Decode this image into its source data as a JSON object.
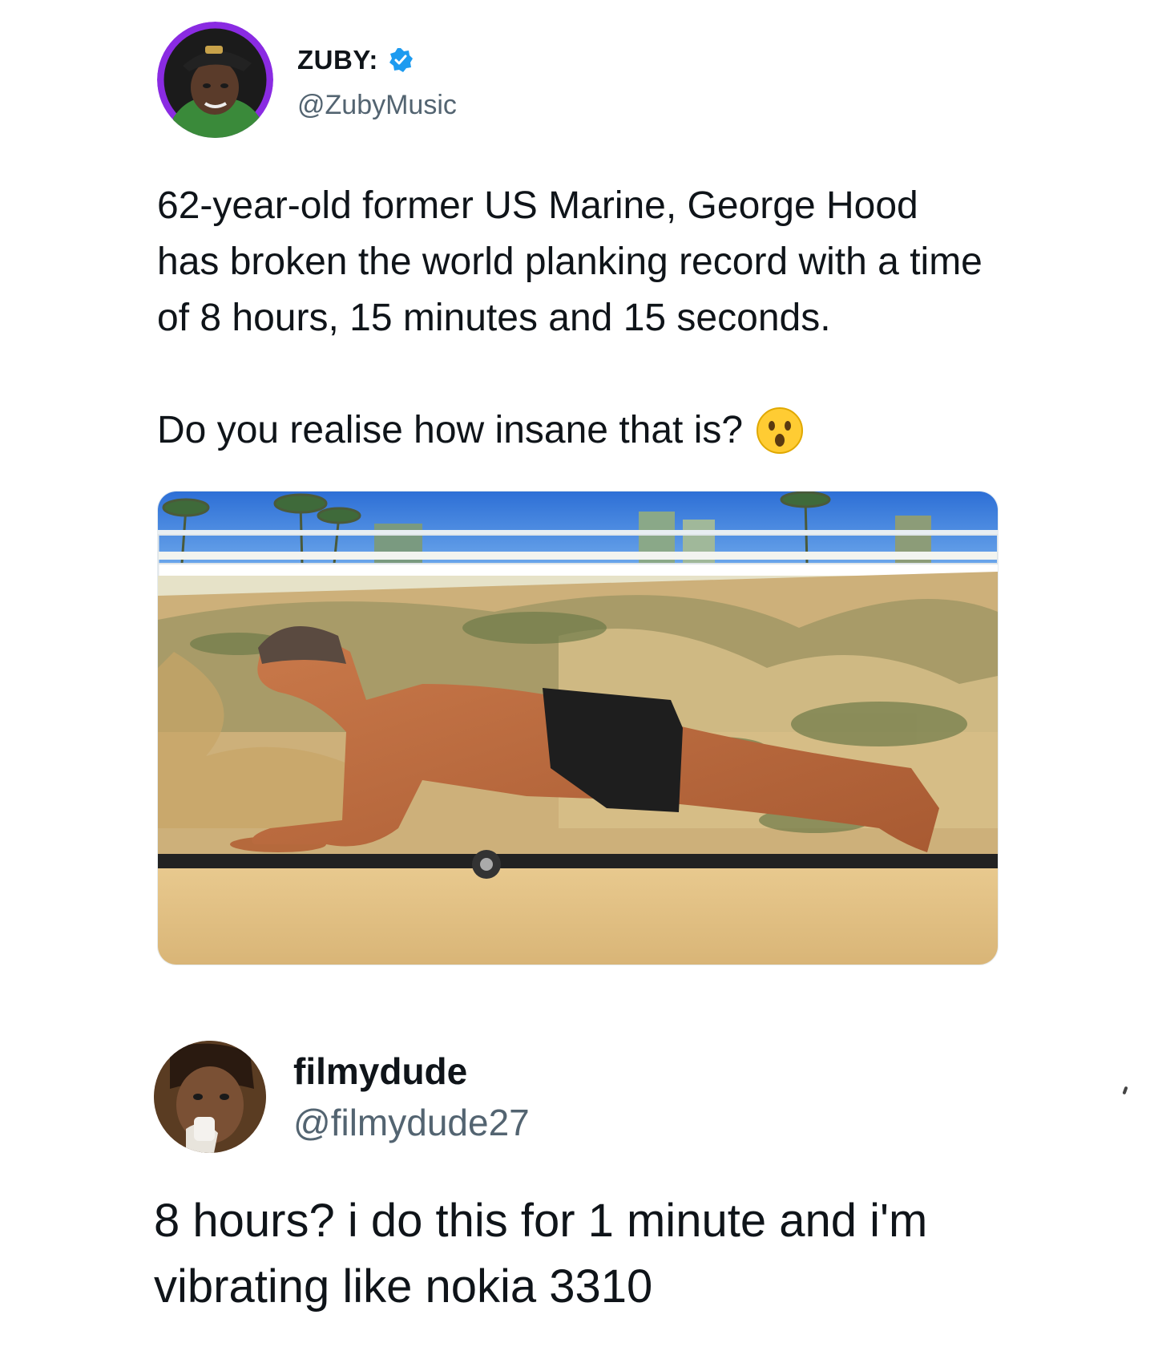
{
  "tweet": {
    "display_name": "ZUBY:",
    "handle": "@ZubyMusic",
    "verified_icon": "verified-badge-icon",
    "verified_color": "#1d9bf0",
    "text_p1": "62-year-old former US Marine, George Hood has broken the world planking record with a time of 8 hours, 15 minutes and 15 seconds.",
    "text_p2": "Do you realise how insane that is?",
    "emoji": "astonished-face-emoji-icon",
    "avatar_ring_color": "#8a2be2"
  },
  "reply": {
    "display_name": "filmydude",
    "handle": "@filmydude27",
    "text": "8 hours? i do this for 1 minute and i'm vibrating like nokia 3310"
  }
}
